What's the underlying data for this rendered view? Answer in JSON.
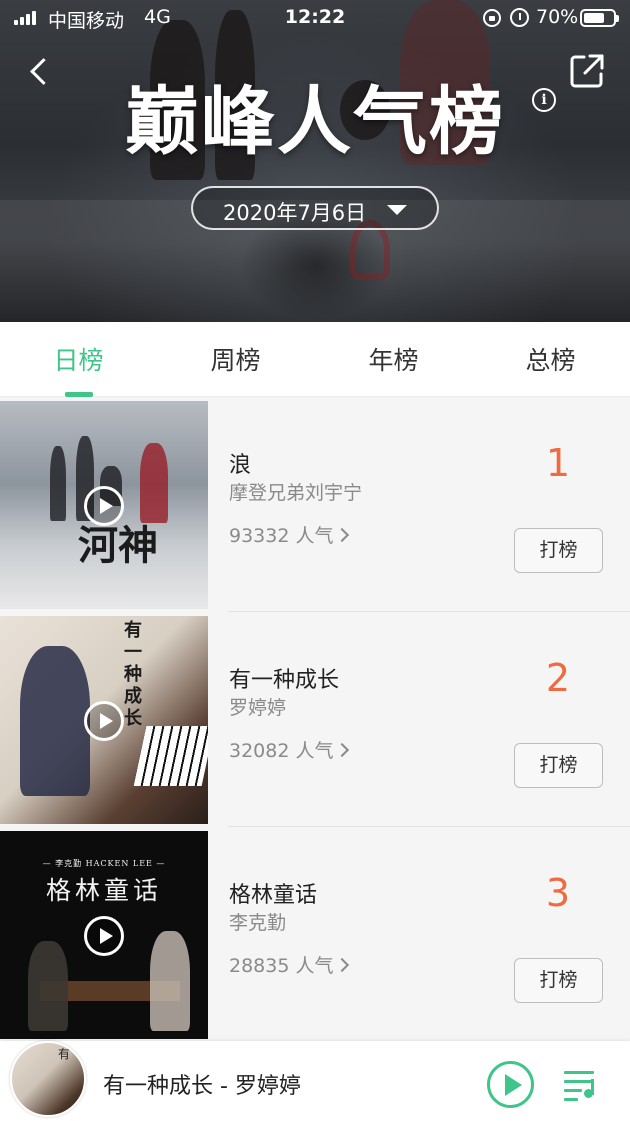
{
  "status_bar": {
    "carrier": "中国移动",
    "network": "4G",
    "time": "12:22",
    "battery": "70%",
    "battery_level": 0.7
  },
  "header": {
    "title": "巅峰人气榜",
    "date": "2020年7月6日",
    "icons": [
      "back-icon",
      "share-icon",
      "info-icon",
      "caret-down-icon"
    ]
  },
  "tabs": [
    {
      "label": "日榜",
      "active": true
    },
    {
      "label": "周榜",
      "active": false
    },
    {
      "label": "年榜",
      "active": false
    },
    {
      "label": "总榜",
      "active": false
    }
  ],
  "songs": [
    {
      "rank": "1",
      "title": "浪",
      "artist": "摩登兄弟刘宇宁",
      "popularity": "93332 人气",
      "button": "打榜",
      "cover_text": "河神"
    },
    {
      "rank": "2",
      "title": "有一种成长",
      "artist": "罗婷婷",
      "popularity": "32082 人气",
      "button": "打榜",
      "cover_text": "有一种成长"
    },
    {
      "rank": "3",
      "title": "格林童话",
      "artist": "李克勤",
      "popularity": "28835 人气",
      "button": "打榜",
      "cover_text": "格林童话",
      "cover_subtext": "— 李克勤 HACKEN LEE —"
    }
  ],
  "player": {
    "now_playing": "有一种成长 - 罗婷婷",
    "icons": [
      "play-icon",
      "playlist-icon"
    ]
  },
  "colors": {
    "accent": "#3fc48a",
    "rank": "#f06a3f"
  }
}
